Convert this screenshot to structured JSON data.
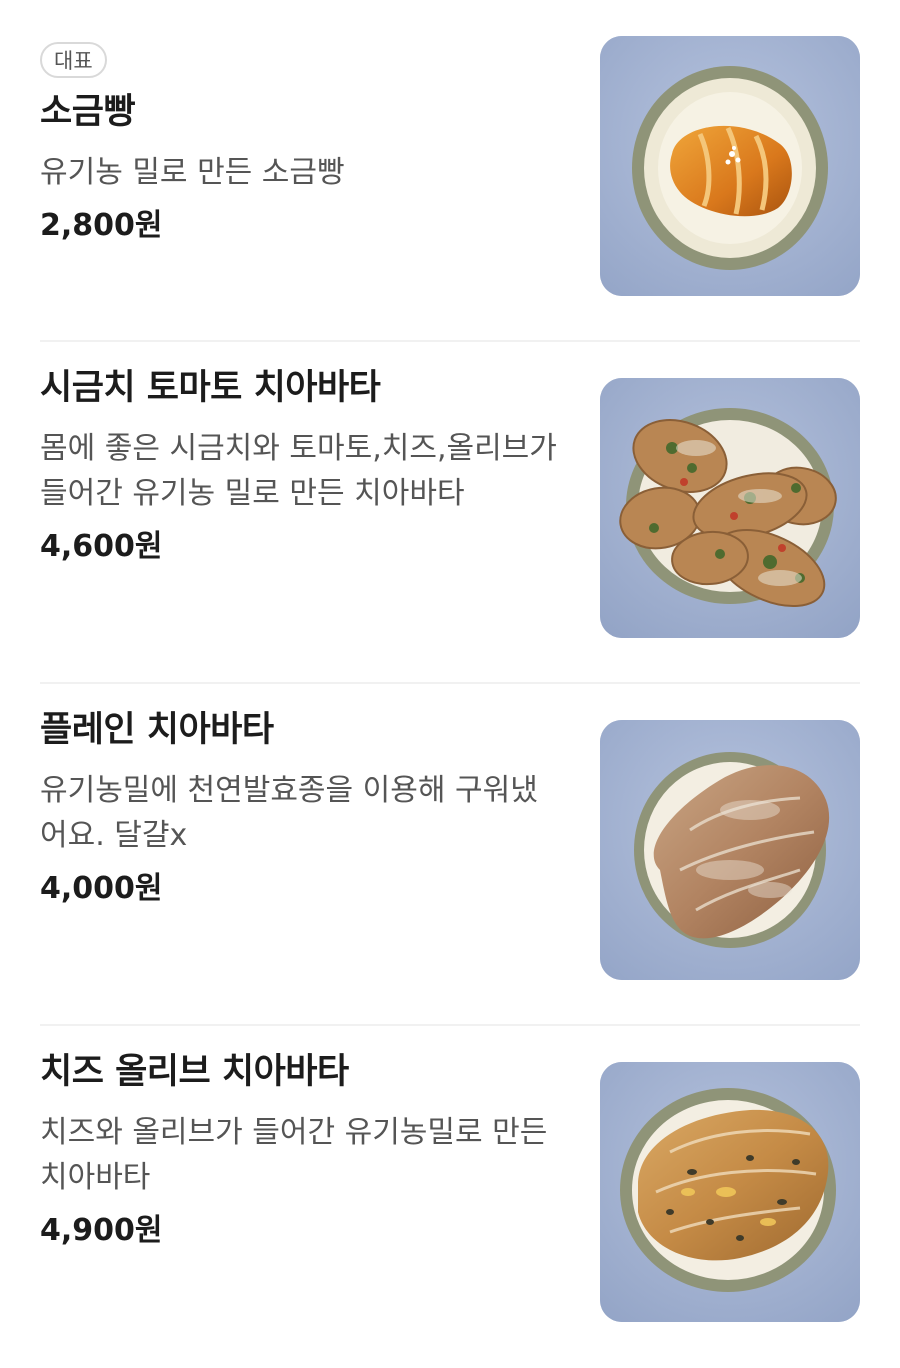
{
  "menu": {
    "items": [
      {
        "badge": "대표",
        "name": "소금빵",
        "description": "유기농 밀로 만든 소금빵",
        "price": "2,800원",
        "image": "salt-bread-photo"
      },
      {
        "name": "시금치 토마토 치아바타",
        "description": "몸에 좋은 시금치와 토마토,치즈,올리브가 들어간 유기농 밀로 만든 치아바타",
        "price": "4,600원",
        "image": "spinach-tomato-ciabatta-photo"
      },
      {
        "name": "플레인 치아바타",
        "description": "유기농밀에 천연발효종을 이용해 구워냈어요. 달걀x",
        "price": "4,000원",
        "image": "plain-ciabatta-photo"
      },
      {
        "name": "치즈 올리브 치아바타",
        "description": "치즈와 올리브가 들어간 유기농밀로 만든 치아바타",
        "price": "4,900원",
        "image": "cheese-olive-ciabatta-photo"
      }
    ]
  }
}
